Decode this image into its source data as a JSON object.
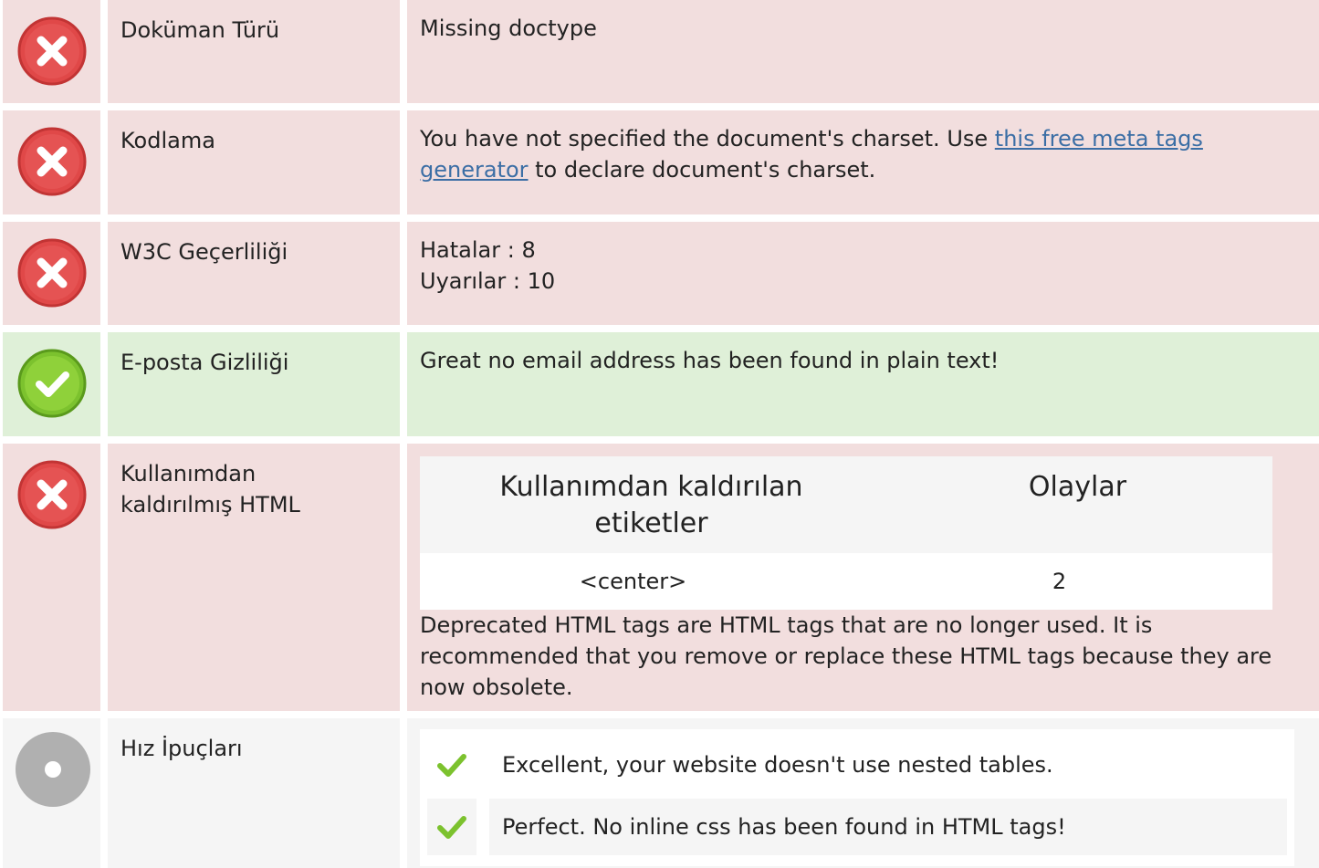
{
  "rows": [
    {
      "label": "Doküman Türü",
      "value": "Missing doctype"
    },
    {
      "label": "Kodlama",
      "value_pre": "You have not specified the document's charset. Use ",
      "value_link": "this free meta tags generator",
      "value_post": " to declare document's charset."
    },
    {
      "label": "W3C Geçerliliği",
      "line1": "Hatalar : 8",
      "line2": "Uyarılar : 10"
    },
    {
      "label": "E-posta Gizliliği",
      "value": "Great no email address has been found in plain text!"
    },
    {
      "label": "Kullanımdan kaldırılmış HTML",
      "table_headers": [
        "Kullanımdan kaldırılan etiketler",
        "Olaylar"
      ],
      "table_rows": [
        [
          "<center>",
          "2"
        ]
      ],
      "note": "Deprecated HTML tags are HTML tags that are no longer used. It is recommended that you remove or replace these HTML tags because they are now obsolete."
    },
    {
      "label": "Hız İpuçları",
      "tips": [
        "Excellent, your website doesn't use nested tables.",
        "Perfect. No inline css has been found in HTML tags!"
      ]
    }
  ],
  "icons": {
    "error": "error-x-icon",
    "success": "success-check-icon",
    "info": "neutral-dot-icon",
    "check": "check-mark-icon"
  },
  "colors": {
    "error_bg": "#f2dede",
    "success_bg": "#dff0d8",
    "neutral_bg": "#f5f5f5",
    "error_icon": "#e04848",
    "success_icon": "#7cc22e",
    "link": "#3b6ea5"
  }
}
